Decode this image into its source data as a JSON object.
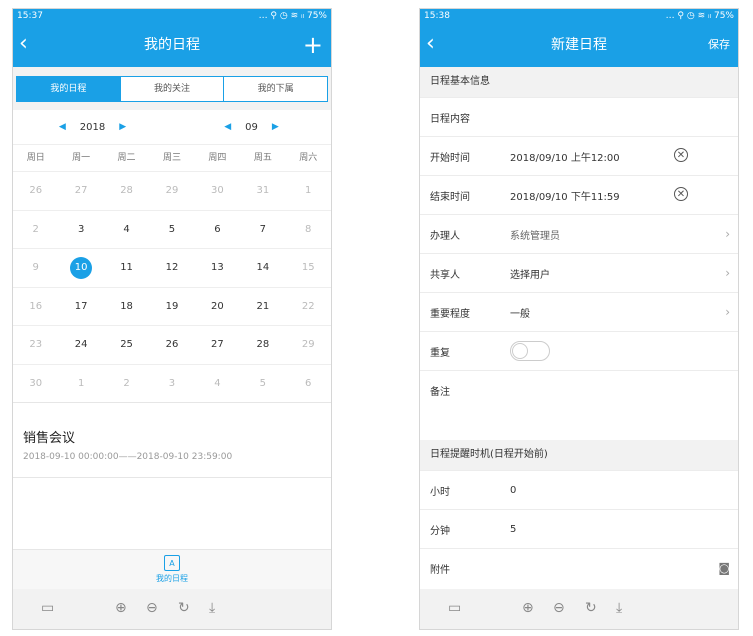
{
  "left": {
    "status": {
      "time": "15:37",
      "icons": "… ⚲ ◷ ≋ ᵢₗ",
      "battery": "75%"
    },
    "nav": {
      "back": "‹",
      "title": "我的日程",
      "add": "+"
    },
    "tabs": [
      "我的日程",
      "我的关注",
      "我的下属"
    ],
    "date": {
      "year": "2018",
      "month": "09",
      "prev": "◀",
      "next": "▶"
    },
    "weekdays": [
      "周日",
      "周一",
      "周二",
      "周三",
      "周四",
      "周五",
      "周六"
    ],
    "calendar": [
      [
        "26",
        "27",
        "28",
        "29",
        "30",
        "31",
        "1"
      ],
      [
        "2",
        "3",
        "4",
        "5",
        "6",
        "7",
        "8"
      ],
      [
        "9",
        "10",
        "11",
        "12",
        "13",
        "14",
        "15"
      ],
      [
        "16",
        "17",
        "18",
        "19",
        "20",
        "21",
        "22"
      ],
      [
        "23",
        "24",
        "25",
        "26",
        "27",
        "28",
        "29"
      ],
      [
        "30",
        "1",
        "2",
        "3",
        "4",
        "5",
        "6"
      ]
    ],
    "selected_day": "10",
    "event": {
      "title": "销售会议",
      "time": "2018-09-10 00:00:00——2018-09-10 23:59:00"
    },
    "bottom_nav": {
      "icon_text": "A",
      "label": "我的日程"
    }
  },
  "right": {
    "status": {
      "time": "15:38",
      "icons": "… ⚲ ◷ ≋ ᵢₗ",
      "battery": "75%"
    },
    "nav": {
      "back": "‹",
      "title": "新建日程",
      "save": "保存"
    },
    "section1": "日程基本信息",
    "content_label": "日程内容",
    "start": {
      "label": "开始时间",
      "value": "2018/09/10 上午12:00"
    },
    "end": {
      "label": "结束时间",
      "value": "2018/09/10 下午11:59"
    },
    "handler": {
      "label": "办理人",
      "value": "系统管理员"
    },
    "share": {
      "label": "共享人",
      "value": "选择用户"
    },
    "importance": {
      "label": "重要程度",
      "value": "一般"
    },
    "repeat": {
      "label": "重复",
      "on": false
    },
    "notes_label": "备注",
    "section2": "日程提醒时机(日程开始前)",
    "hours": {
      "label": "小时",
      "value": "0"
    },
    "minutes": {
      "label": "分钟",
      "value": "5"
    },
    "attachment_label": "附件"
  },
  "toolbar_icons": [
    "▭",
    "⊕",
    "⊖",
    "↻",
    "⤓"
  ],
  "colors": {
    "accent": "#1aa0e6"
  }
}
